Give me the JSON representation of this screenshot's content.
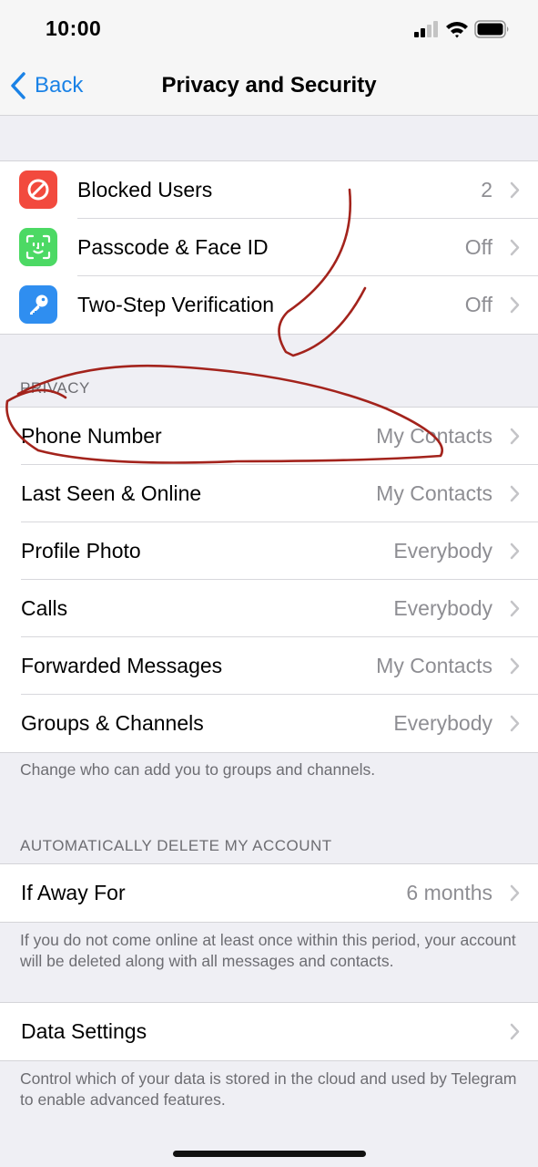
{
  "status_bar": {
    "time": "10:00"
  },
  "nav": {
    "back_label": "Back",
    "title": "Privacy and Security"
  },
  "security_items": [
    {
      "label": "Blocked Users",
      "value": "2",
      "icon": "blocked-icon",
      "color": "#f24a3e"
    },
    {
      "label": "Passcode & Face ID",
      "value": "Off",
      "icon": "face-id-icon",
      "color": "#4cd964"
    },
    {
      "label": "Two-Step Verification",
      "value": "Off",
      "icon": "key-icon",
      "color": "#2f8ef0"
    }
  ],
  "privacy": {
    "header": "PRIVACY",
    "items": [
      {
        "label": "Phone Number",
        "value": "My Contacts"
      },
      {
        "label": "Last Seen & Online",
        "value": "My Contacts"
      },
      {
        "label": "Profile Photo",
        "value": "Everybody"
      },
      {
        "label": "Calls",
        "value": "Everybody"
      },
      {
        "label": "Forwarded Messages",
        "value": "My Contacts"
      },
      {
        "label": "Groups & Channels",
        "value": "Everybody"
      }
    ],
    "footer": "Change who can add you to groups and channels."
  },
  "auto_delete": {
    "header": "AUTOMATICALLY DELETE MY ACCOUNT",
    "item": {
      "label": "If Away For",
      "value": "6 months"
    },
    "footer": "If you do not come online at least once within this period, your account will be deleted along with all messages and contacts."
  },
  "data_settings": {
    "item": {
      "label": "Data Settings"
    },
    "footer": "Control which of your data is stored in the cloud and used by Telegram to enable advanced features."
  },
  "colors": {
    "accent": "#1a82e6",
    "annotation": "#a3231c",
    "secondary_text": "#8e8e93"
  }
}
